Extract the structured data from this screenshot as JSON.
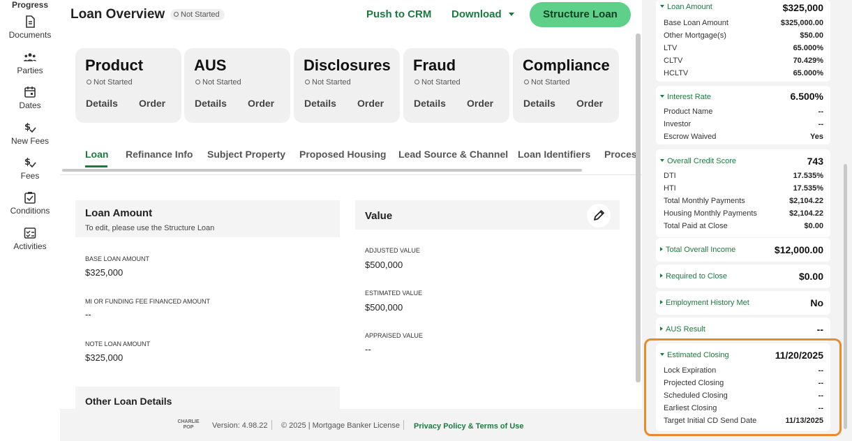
{
  "rail": {
    "progress": "Progress",
    "items": [
      {
        "label": "Documents",
        "icon": "document-icon"
      },
      {
        "label": "Parties",
        "icon": "parties-icon"
      },
      {
        "label": "Dates",
        "icon": "calendar-icon"
      },
      {
        "label": "New Fees",
        "icon": "dollar-check-icon"
      },
      {
        "label": "Fees",
        "icon": "dollar-check-icon"
      },
      {
        "label": "Conditions",
        "icon": "clipboard-check-icon"
      },
      {
        "label": "Activities",
        "icon": "checklist-icon"
      }
    ]
  },
  "header": {
    "title": "Loan Overview",
    "status": "Not Started",
    "push_crm": "Push to CRM",
    "download": "Download",
    "structure_loan": "Structure Loan"
  },
  "cards": [
    {
      "name": "Product",
      "status": "Not Started",
      "details": "Details",
      "order": "Order"
    },
    {
      "name": "AUS",
      "status": "Not Started",
      "details": "Details",
      "order": "Order"
    },
    {
      "name": "Disclosures",
      "status": "Not Started",
      "details": "Details",
      "order": "Order"
    },
    {
      "name": "Fraud",
      "status": "Not Started",
      "details": "Details",
      "order": "Order"
    },
    {
      "name": "Compliance",
      "status": "Not Started",
      "details": "Details",
      "order": "Order"
    }
  ],
  "tabs": [
    "Loan",
    "Refinance Info",
    "Subject Property",
    "Proposed Housing",
    "Lead Source & Channel",
    "Loan Identifiers",
    "Process"
  ],
  "loan_amount": {
    "title": "Loan Amount",
    "subtitle": "To edit, please use the Structure Loan",
    "fields": [
      {
        "label": "BASE LOAN AMOUNT",
        "value": "$325,000"
      },
      {
        "label": "MI OR FUNDING FEE FINANCED AMOUNT",
        "value": "--"
      },
      {
        "label": "NOTE LOAN AMOUNT",
        "value": "$325,000"
      }
    ]
  },
  "value_panel": {
    "title": "Value",
    "fields": [
      {
        "label": "ADJUSTED VALUE",
        "value": "$500,000"
      },
      {
        "label": "ESTIMATED VALUE",
        "value": "$500,000"
      },
      {
        "label": "APPRAISED VALUE",
        "value": "--"
      }
    ]
  },
  "other_loan": {
    "title": "Other Loan Details"
  },
  "footer": {
    "logo": "CHARLIE POP",
    "version": "Version: 4.98.22",
    "copyright": "© 2025 | Mortgage Banker License",
    "privacy": "Privacy Policy & Terms of Use"
  },
  "right": {
    "loan_amount": {
      "head": "Loan Amount",
      "value": "$325,000",
      "rows": [
        {
          "k": "Base Loan Amount",
          "v": "$325,000.00"
        },
        {
          "k": "Other Mortgage(s)",
          "v": "$50.00"
        },
        {
          "k": "LTV",
          "v": "65.000%"
        },
        {
          "k": "CLTV",
          "v": "70.429%"
        },
        {
          "k": "HCLTV",
          "v": "65.000%"
        }
      ]
    },
    "interest_rate": {
      "head": "Interest Rate",
      "value": "6.500%",
      "rows": [
        {
          "k": "Product Name",
          "v": "--"
        },
        {
          "k": "Investor",
          "v": "--"
        },
        {
          "k": "Escrow Waived",
          "v": "Yes"
        }
      ]
    },
    "credit_score": {
      "head": "Overall Credit Score",
      "value": "743",
      "rows": [
        {
          "k": "DTI",
          "v": "17.535%"
        },
        {
          "k": "HTI",
          "v": "17.535%"
        },
        {
          "k": "Total Monthly Payments",
          "v": "$2,104.22"
        },
        {
          "k": "Housing Monthly Payments",
          "v": "$2,104.22"
        },
        {
          "k": "Total Paid at Close",
          "v": "$0.00"
        }
      ]
    },
    "income": {
      "head": "Total Overall Income",
      "value": "$12,000.00"
    },
    "required_close": {
      "head": "Required to Close",
      "value": "$0.00"
    },
    "employment": {
      "head": "Employment History Met",
      "value": "No"
    },
    "aus_result": {
      "head": "AUS Result",
      "value": "--"
    },
    "estimated_closing": {
      "head": "Estimated Closing",
      "value": "11/20/2025",
      "rows": [
        {
          "k": "Lock Expiration",
          "v": "--"
        },
        {
          "k": "Projected Closing",
          "v": "--"
        },
        {
          "k": "Scheduled Closing",
          "v": "--"
        },
        {
          "k": "Earliest Closing",
          "v": "--"
        },
        {
          "k": "Target Initial CD Send Date",
          "v": "11/13/2025"
        }
      ]
    }
  },
  "colors": {
    "accent": "#1b7a3e",
    "button": "#5ed08a",
    "highlight": "#ea8a2e"
  }
}
